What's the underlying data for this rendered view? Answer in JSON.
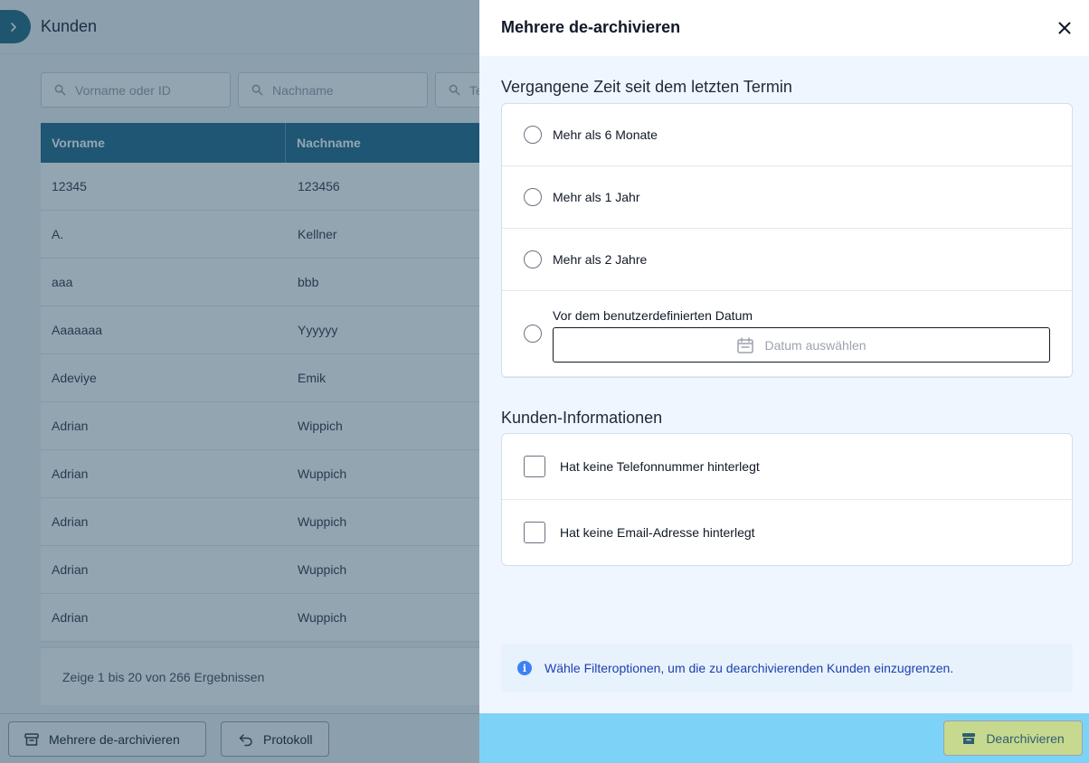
{
  "app": {
    "page_title": "Kunden",
    "filters": [
      {
        "placeholder": "Vorname oder ID"
      },
      {
        "placeholder": "Nachname"
      },
      {
        "placeholder": "Te"
      }
    ],
    "table": {
      "columns": [
        "Vorname",
        "Nachname"
      ],
      "rows": [
        [
          "12345",
          "123456"
        ],
        [
          "A.",
          "Kellner"
        ],
        [
          "aaa",
          "bbb"
        ],
        [
          "Aaaaaaa",
          "Yyyyyy"
        ],
        [
          "Adeviye",
          "Emik"
        ],
        [
          "Adrian",
          "Wippich"
        ],
        [
          "Adrian",
          "Wuppich"
        ],
        [
          "Adrian",
          "Wuppich"
        ],
        [
          "Adrian",
          "Wuppich"
        ],
        [
          "Adrian",
          "Wuppich"
        ]
      ],
      "footer": "Zeige 1 bis 20 von 266 Ergebnissen"
    },
    "bottom_bar": {
      "bulk_unarchive_label": "Mehrere de-archivieren",
      "protocol_label": "Protokoll"
    }
  },
  "drawer": {
    "title": "Mehrere de-archivieren",
    "time_section_title": "Vergangene Zeit seit dem letzten Termin",
    "time_options": [
      "Mehr als 6 Monate",
      "Mehr als 1 Jahr",
      "Mehr als 2 Jahre",
      "Vor dem benutzerdefinierten Datum"
    ],
    "date_placeholder": "Datum auswählen",
    "customer_section_title": "Kunden-Informationen",
    "customer_options": [
      "Hat keine Telefonnummer hinterlegt",
      "Hat keine Email-Adresse hinterlegt"
    ],
    "info_text": "Wähle Filteroptionen, um die zu dearchivierenden Kunden einzugrenzen.",
    "submit_label": "Dearchivieren"
  },
  "colors": {
    "table_header": "#2a6f90",
    "overlay": "#103752",
    "drawer_footer": "#7dd3f7",
    "submit_button": "#c6d98e",
    "info_text": "#1e40af"
  },
  "icons": [
    "chevron-right-icon",
    "search-icon",
    "close-icon",
    "calendar-icon",
    "info-icon",
    "archive-icon",
    "undo-icon"
  ]
}
